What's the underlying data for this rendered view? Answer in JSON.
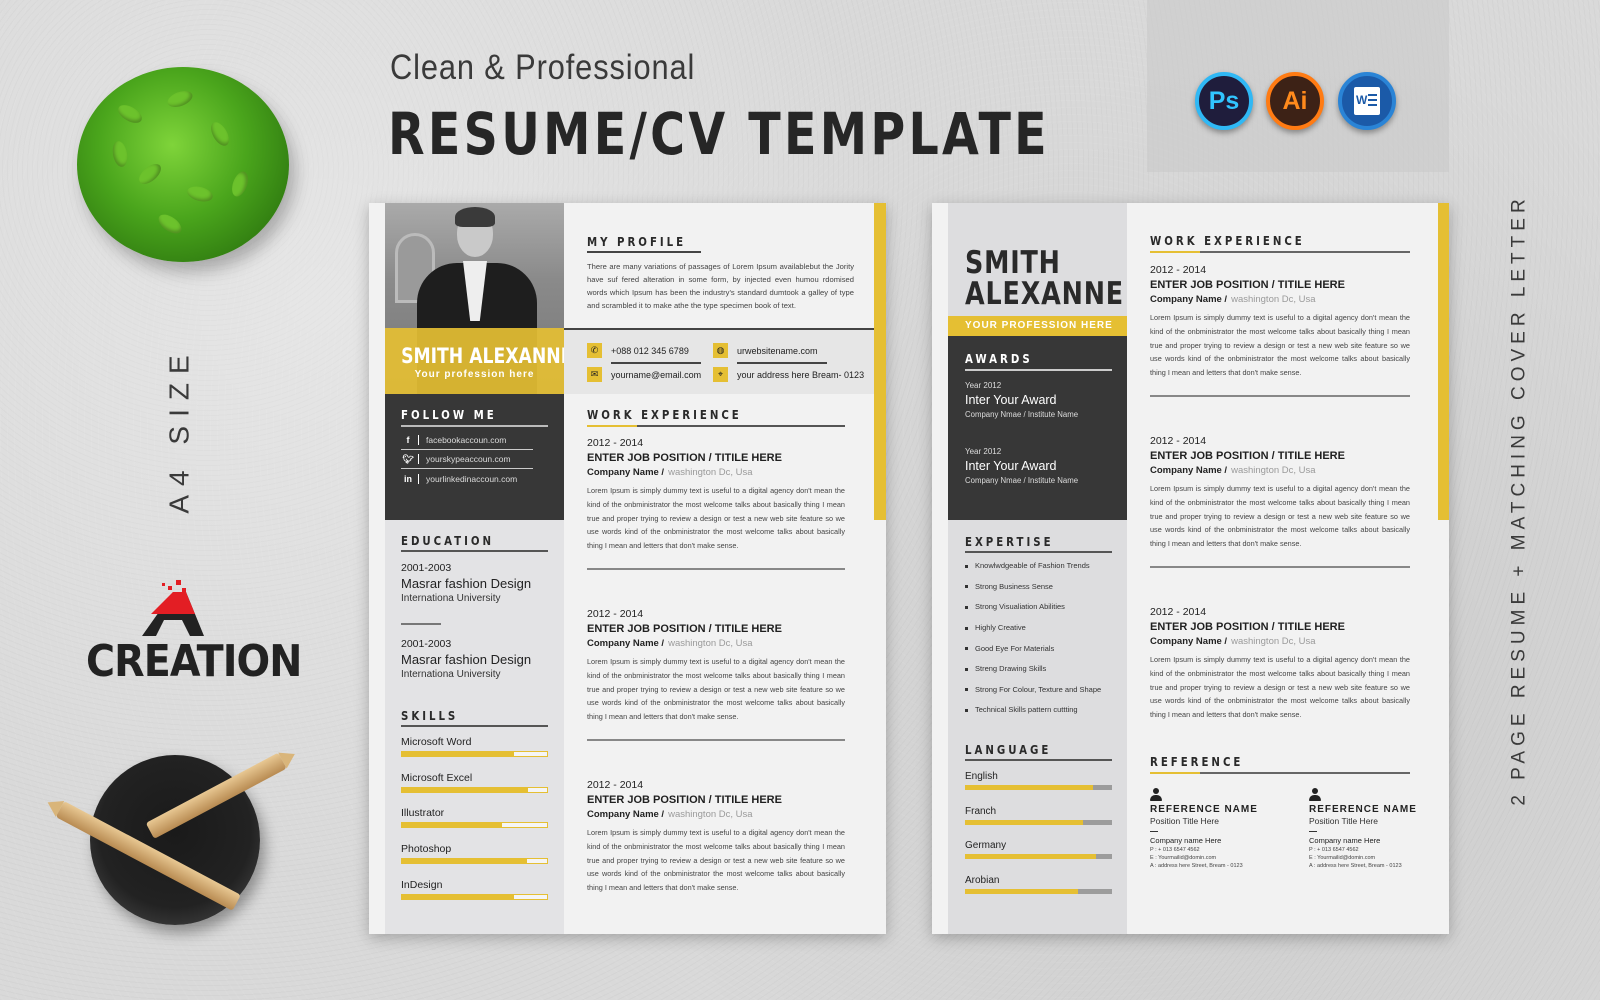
{
  "header": {
    "subtitle": "Clean & Professional",
    "title": "RESUME/CV TEMPLATE"
  },
  "app_icons": [
    {
      "name": "photoshop-icon",
      "label": "Ps",
      "color": "#2fb8f5"
    },
    {
      "name": "illustrator-icon",
      "label": "Ai",
      "color": "#ff7b13"
    },
    {
      "name": "word-icon",
      "label": "W",
      "color": "#2a84d6"
    }
  ],
  "left_side": {
    "size_label": "A4 SIZE",
    "logo_text": "CREATION"
  },
  "right_side": {
    "vertical_label": "2 PAGE RESUME + MATCHING COVER LETTER"
  },
  "accent_color": "#e5bf33",
  "page1": {
    "name": "SMITH ALEXANNE",
    "profession": "Your profession here",
    "follow": {
      "heading": "FOLLOW ME",
      "items": [
        {
          "icon": "facebook-icon",
          "glyph": "f",
          "text": "facebookaccoun.com"
        },
        {
          "icon": "twitter-icon",
          "glyph": "t",
          "text": "yourskypeaccoun.com"
        },
        {
          "icon": "linkedin-icon",
          "glyph": "in",
          "text": "yourlinkedinaccoun.com"
        }
      ]
    },
    "education": {
      "heading": "EDUCATION",
      "items": [
        {
          "years": "2001-2003",
          "degree": "Masrar fashion Design",
          "school": "Internationa University"
        },
        {
          "years": "2001-2003",
          "degree": "Masrar fashion Design",
          "school": "Internationa University"
        }
      ]
    },
    "skills": {
      "heading": "SKILLS",
      "items": [
        {
          "label": "Microsoft Word",
          "level": 0.77
        },
        {
          "label": "Microsoft Excel",
          "level": 0.87
        },
        {
          "label": "Illustrator",
          "level": 0.69
        },
        {
          "label": "Photoshop",
          "level": 0.86
        },
        {
          "label": "InDesign",
          "level": 0.77
        }
      ]
    },
    "profile": {
      "heading": "MY PROFILE",
      "text": "There are many variations of passages of Lorem Ipsum availablebut the Jority have suf fered alteration in some form, by injected even humou rdomised words which Ipsum has been the industry's standard dumtook a galley of type and scrambled it to make athe  the type specimen book of text."
    },
    "contact": {
      "phone": "+088 012 345 6789",
      "website": "urwebsitename.com",
      "email": "yourname@email.com",
      "address": "your address here Bream- 0123"
    },
    "work": {
      "heading": "WORK EXPERIENCE",
      "jobs": [
        {
          "years": "2012 - 2014",
          "position": "ENTER JOB POSITION / TITILE HERE",
          "company": "Company Name /",
          "location": "washington Dc, Usa",
          "description": "Lorem Ipsum is simply dummy text is useful to a digital agency don't mean the kind of  the onbministrator the most welcome talks about basically thing I mean true and proper trying to review a design or test a new web site feature so we use words kind of  the onbministrator the most welcome talks about basically thing I mean  and letters that don't make sense."
        },
        {
          "years": "2012 - 2014",
          "position": "ENTER JOB POSITION / TITILE HERE",
          "company": "Company Name /",
          "location": "washington Dc, Usa",
          "description": "Lorem Ipsum is simply dummy text is useful to a digital agency don't mean the kind of  the onbministrator the most welcome talks about basically thing I mean true and proper trying to review a design or test a new web site feature so we use words kind of  the onbministrator the most welcome talks about basically thing I mean  and letters that don't make sense."
        },
        {
          "years": "2012 - 2014",
          "position": "ENTER JOB POSITION / TITILE HERE",
          "company": "Company Name /",
          "location": "washington Dc, Usa",
          "description": "Lorem Ipsum is simply dummy text is useful to a digital agency don't mean the kind of  the onbministrator the most welcome talks about basically thing I mean true and proper trying to review a design or test a new web site feature so we use words kind of  the onbministrator the most welcome talks about basically thing I mean  and letters that don't make sense."
        }
      ]
    }
  },
  "page2": {
    "first_name": "SMITH",
    "last_name": "ALEXANNE",
    "profession": "YOUR PROFESSION HERE",
    "awards": {
      "heading": "AWARDS",
      "items": [
        {
          "year": "Year 2012",
          "title": "Inter Your Award",
          "org": "Company Nmae / Institute Name"
        },
        {
          "year": "Year 2012",
          "title": "Inter Your Award",
          "org": "Company Nmae / Institute Name"
        }
      ]
    },
    "expertise": {
      "heading": "EXPERTISE",
      "items": [
        "Knowlwdgeable of Fashion Trends",
        "Strong Business Sense",
        "Strong Visualiation Abilities",
        "Highly Creative",
        "Good Eye For Materials",
        "Streng Drawing Skills",
        "Strong For Colour, Texture and Shape",
        "Technical  Skills pattern cuttting"
      ]
    },
    "language": {
      "heading": "LANGUAGE",
      "items": [
        {
          "label": "English",
          "level": 0.87
        },
        {
          "label": "Franch",
          "level": 0.8
        },
        {
          "label": "Germany",
          "level": 0.89
        },
        {
          "label": "Arobian",
          "level": 0.77
        }
      ]
    },
    "work": {
      "heading": "WORK EXPERIENCE",
      "jobs": [
        {
          "years": "2012 - 2014",
          "position": "ENTER JOB POSITION / TITILE HERE",
          "company": "Company Name /",
          "location": "washington Dc, Usa",
          "description": "Lorem Ipsum is simply dummy text is useful to a digital agency don't mean the kind of  the onbministrator the most welcome talks about basically thing I mean true and proper trying to review a design or test a new web site feature so we use words kind of  the onbministrator the most welcome talks about basically thing I mean  and letters that don't make sense."
        },
        {
          "years": "2012 - 2014",
          "position": "ENTER JOB POSITION / TITILE HERE",
          "company": "Company Name /",
          "location": "washington Dc, Usa",
          "description": "Lorem Ipsum is simply dummy text is useful to a digital agency don't mean the kind of  the onbministrator the most welcome talks about basically thing I mean true and proper trying to review a design or test a new web site feature so we use words kind of  the onbministrator the most welcome talks about basically thing I mean  and letters that don't make sense."
        },
        {
          "years": "2012 - 2014",
          "position": "ENTER JOB POSITION / TITILE HERE",
          "company": "Company Name /",
          "location": "washington Dc, Usa",
          "description": "Lorem Ipsum is simply dummy text is useful to a digital agency don't mean the kind of  the onbministrator the most welcome talks about basically thing I mean true and proper trying to review a design or test a new web site feature so we use words kind of  the onbministrator the most welcome talks about basically thing I mean  and letters that don't make sense."
        }
      ]
    },
    "reference": {
      "heading": "REFERENCE",
      "items": [
        {
          "name": "REFERENCE  NAME",
          "position": "Position Title Here",
          "company": "Company  name Here",
          "phone": "P : + 013 6547 4562",
          "email": "E : Yourmailid@domin.com",
          "address": "A : address here Street, Bream - 0123"
        },
        {
          "name": "REFERENCE  NAME",
          "position": "Position Title Here",
          "company": "Company  name Here",
          "phone": "P : + 013 6547 4562",
          "email": "E : Yourmailid@domin.com",
          "address": "A : address here Street, Bream - 0123"
        }
      ]
    }
  }
}
